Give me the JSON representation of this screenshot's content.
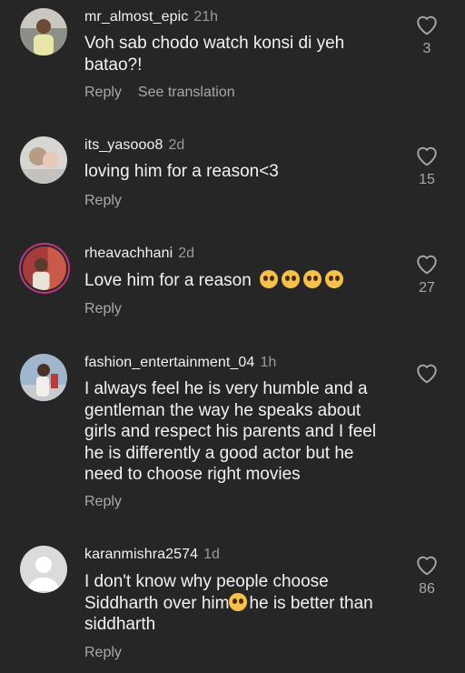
{
  "comments": [
    {
      "username": "mr_almost_epic",
      "time": "21h",
      "text": "Voh sab chodo watch konsi di yeh batao?!",
      "reply": "Reply",
      "translate": "See translation",
      "likes": "3"
    },
    {
      "username": "its_yasooo8",
      "time": "2d",
      "text": "loving him for a reason<3",
      "reply": "Reply",
      "likes": "15"
    },
    {
      "username": "rheavachhani",
      "time": "2d",
      "text": "Love him for a reason",
      "emojis": [
        "pleading-face-emoji",
        "pleading-face-emoji",
        "pleading-face-emoji",
        "pleading-face-emoji"
      ],
      "reply": "Reply",
      "likes": "27"
    },
    {
      "username": "fashion_entertainment_04",
      "time": "1h",
      "text": "I always feel he is very humble and a gentleman the way he speaks about girls and respect his parents and I feel he is differently a good actor but he need to choose right movies",
      "reply": "Reply",
      "likes": ""
    },
    {
      "username": "karanmishra2574",
      "time": "1d",
      "text_before": "I don't know why people choose Siddharth over him",
      "text_after": "he is better than siddharth",
      "emoji": "crying-face-emoji",
      "reply": "Reply",
      "likes": "86"
    }
  ],
  "colors": {
    "background": "#262626",
    "text": "#f2f2f2",
    "secondary": "#a8a8a8",
    "story_ring": "#c13584"
  },
  "icons": {
    "like": "heart-outline-icon",
    "default_avatar": "default-avatar-icon"
  }
}
